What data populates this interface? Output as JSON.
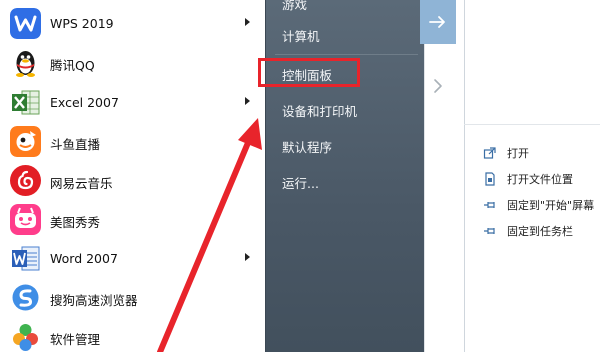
{
  "programs": [
    {
      "label": "WPS 2019",
      "has_submenu": true,
      "icon": "wps-icon"
    },
    {
      "label": "腾讯QQ",
      "has_submenu": false,
      "icon": "qq-penguin-icon"
    },
    {
      "label": "Excel 2007",
      "has_submenu": true,
      "icon": "excel-icon"
    },
    {
      "label": "斗鱼直播",
      "has_submenu": false,
      "icon": "douyu-fish-icon"
    },
    {
      "label": "网易云音乐",
      "has_submenu": false,
      "icon": "netease-music-icon"
    },
    {
      "label": "美图秀秀",
      "has_submenu": false,
      "icon": "meitu-icon"
    },
    {
      "label": "Word 2007",
      "has_submenu": true,
      "icon": "word-icon"
    },
    {
      "label": "搜狗高速浏览器",
      "has_submenu": false,
      "icon": "sogou-browser-icon"
    },
    {
      "label": "软件管理",
      "has_submenu": false,
      "icon": "software-manager-icon"
    }
  ],
  "right_links": {
    "top_partial": "游戏",
    "computer": "计算机",
    "control_panel": "控制面板",
    "devices_printers": "设备和打印机",
    "default_programs": "默认程序",
    "run": "运行..."
  },
  "jump_list": [
    {
      "label": "打开",
      "icon": "open-icon"
    },
    {
      "label": "打开文件位置",
      "icon": "file-location-icon"
    },
    {
      "label": "固定到\"开始\"屏幕",
      "icon": "pin-icon"
    },
    {
      "label": "固定到任务栏",
      "icon": "pin-icon"
    }
  ],
  "colors": {
    "highlight_box": "#e8242b",
    "annotation_arrow": "#e8242b",
    "pane_dark": "#4a5866",
    "arrow_tile": "#8fb4d6"
  }
}
